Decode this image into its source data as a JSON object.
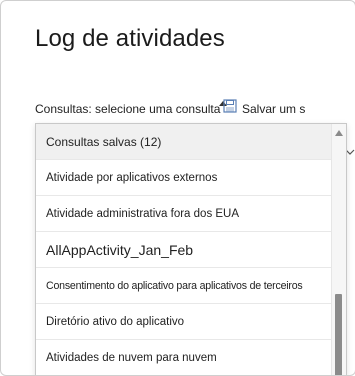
{
  "page": {
    "title": "Log de atividades"
  },
  "query_bar": {
    "label": "Consultas: selecione uma consulta",
    "save_label": "Salvar um s",
    "save_icon": "save-icon",
    "caret_icon": "caret-up-icon"
  },
  "dropdown": {
    "items": [
      {
        "label": "Consultas salvas (12)"
      },
      {
        "label": "Atividade por aplicativos externos"
      },
      {
        "label": "Atividade administrativa fora dos EUA"
      },
      {
        "label": "AllAppActivity_Jan_Feb"
      },
      {
        "label": "Consentimento do aplicativo para aplicativos de terceiros"
      },
      {
        "label": "Diretório ativo do aplicativo"
      },
      {
        "label": "Atividades de nuvem para nuvem"
      }
    ],
    "scroll_position": 0.68
  },
  "colors": {
    "header_bg": "#f0f0f0",
    "border": "#c8c8c8",
    "scroll_thumb": "#8b8b8b",
    "save_icon": "#5a7fb5"
  }
}
